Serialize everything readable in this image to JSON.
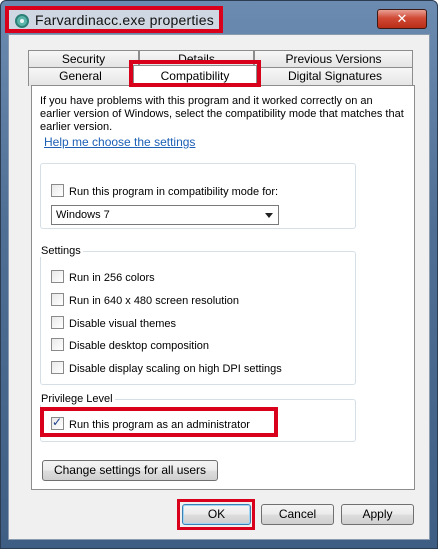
{
  "window": {
    "title": "Farvardinacc.exe properties",
    "close_glyph": "✕"
  },
  "tabs": {
    "row1": [
      "Security",
      "Details",
      "Previous Versions"
    ],
    "row2": [
      "General",
      "Compatibility",
      "Digital Signatures"
    ],
    "active": "Compatibility"
  },
  "panel": {
    "intro": "If you have problems with this program and it worked correctly on an earlier version of Windows, select the compatibility mode that matches that earlier version.",
    "help_link": "Help me choose the settings",
    "compat_mode": {
      "checkbox_label": "Run this program in compatibility mode for:",
      "checked": false,
      "selected_os": "Windows 7"
    },
    "settings": {
      "label": "Settings",
      "items": [
        {
          "label": "Run in 256 colors",
          "checked": false
        },
        {
          "label": "Run in 640 x 480 screen resolution",
          "checked": false
        },
        {
          "label": "Disable visual themes",
          "checked": false
        },
        {
          "label": "Disable desktop composition",
          "checked": false
        },
        {
          "label": "Disable display scaling on high DPI settings",
          "checked": false
        }
      ]
    },
    "privilege": {
      "label": "Privilege Level",
      "checkbox_label": "Run this program as an administrator",
      "checked": true
    },
    "change_all_users": "Change settings for all users"
  },
  "buttons": {
    "ok": "OK",
    "cancel": "Cancel",
    "apply": "Apply"
  },
  "colors": {
    "highlight_red": "#d9001b",
    "link_blue": "#1c5fb5"
  }
}
